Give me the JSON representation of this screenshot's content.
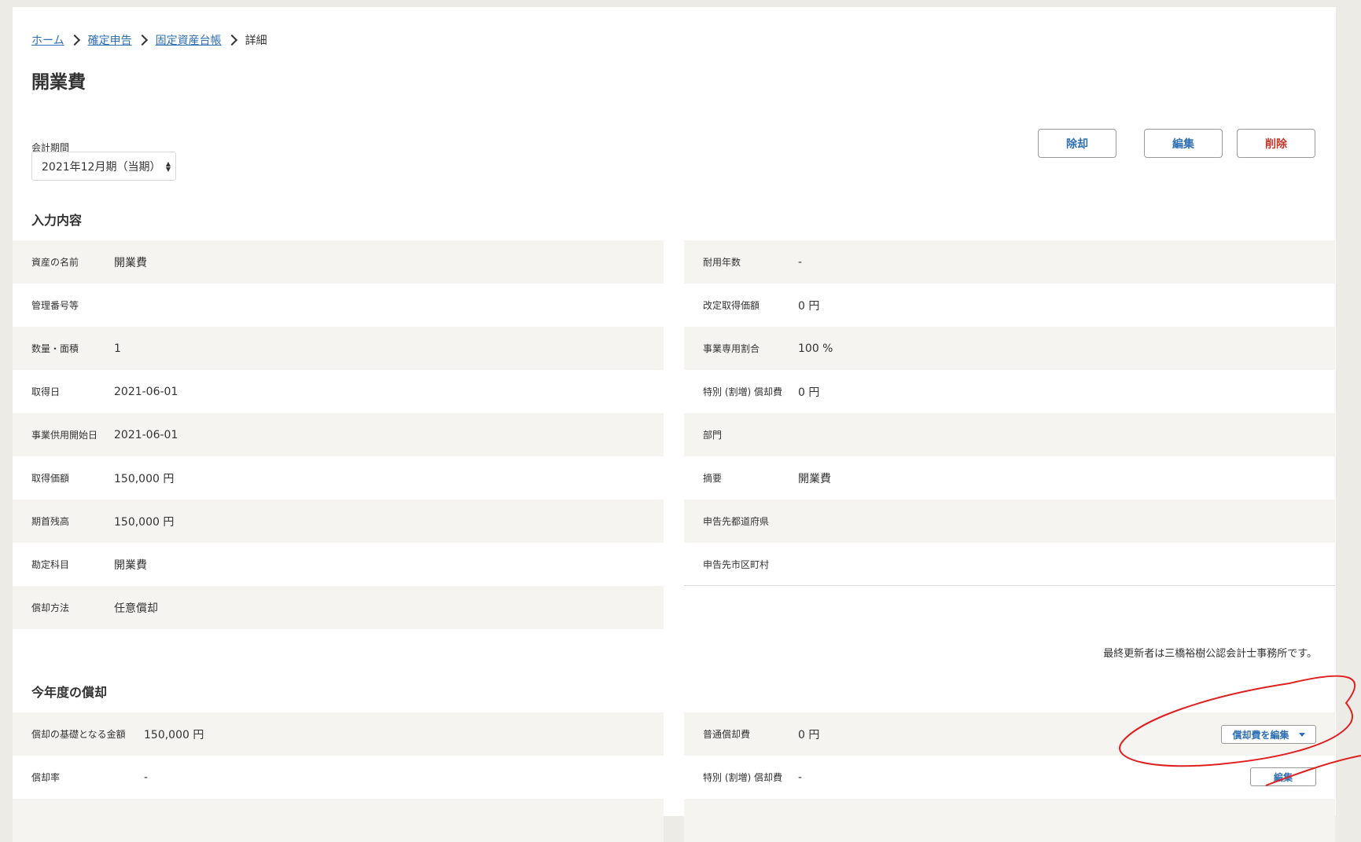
{
  "breadcrumb": {
    "home": "ホーム",
    "tax_return": "確定申告",
    "fixed_assets": "固定資産台帳",
    "current": "詳細"
  },
  "page_title": "開業費",
  "period": {
    "label": "会計期間",
    "selected": "2021年12月期（当期）"
  },
  "actions": {
    "dispose": "除却",
    "edit": "編集",
    "delete": "削除"
  },
  "input_section": {
    "title": "入力内容",
    "left_rows": [
      {
        "label": "資産の名前",
        "value": "開業費"
      },
      {
        "label": "管理番号等",
        "value": ""
      },
      {
        "label": "数量・面積",
        "value": "1"
      },
      {
        "label": "取得日",
        "value": "2021-06-01"
      },
      {
        "label": "事業供用開始日",
        "value": "2021-06-01"
      },
      {
        "label": "取得価額",
        "value": "150,000 円"
      },
      {
        "label": "期首残高",
        "value": "150,000 円"
      },
      {
        "label": "勘定科目",
        "value": "開業費"
      },
      {
        "label": "償却方法",
        "value": "任意償却"
      }
    ],
    "right_rows": [
      {
        "label": "耐用年数",
        "value": "-"
      },
      {
        "label": "改定取得価額",
        "value": "0 円"
      },
      {
        "label": "事業専用割合",
        "value": "100 %"
      },
      {
        "label": "特別 (割増) 償却費",
        "value": "0 円"
      },
      {
        "label": "部門",
        "value": ""
      },
      {
        "label": "摘要",
        "value": "開業費"
      },
      {
        "label": "申告先都道府県",
        "value": ""
      },
      {
        "label": "申告先市区町村",
        "value": ""
      }
    ],
    "updated_note": "最終更新者は三橋裕樹公認会計士事務所です。"
  },
  "depreciation_section": {
    "title": "今年度の償却",
    "left_rows": [
      {
        "label": "償却の基礎となる金額",
        "value": "150,000 円"
      },
      {
        "label": "償却率",
        "value": "-"
      }
    ],
    "right_rows": [
      {
        "label": "普通償却費",
        "value": "0 円"
      },
      {
        "label": "特別 (割増) 償却費",
        "value": "-"
      }
    ],
    "edit_depreciation_button": "償却費を編集",
    "edit_button": "編集"
  },
  "colors": {
    "link": "#2f6fb3",
    "danger": "#c0392b",
    "row_shade": "#f5f4f1",
    "annotation": "#e02020"
  }
}
